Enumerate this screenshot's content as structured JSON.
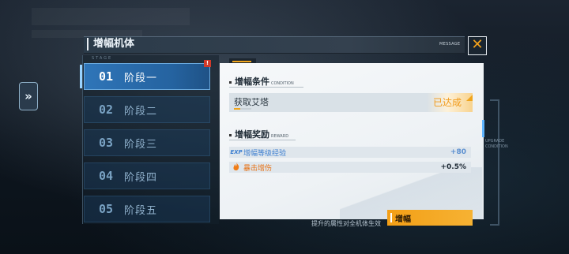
{
  "header": {
    "title": "增幅机体",
    "message_label": "MESSAGE",
    "close_glyph": "✕"
  },
  "nav": {
    "side_arrow": "»"
  },
  "stages": {
    "label": "STAGE",
    "badge": "!",
    "items": [
      {
        "num": "01",
        "name": "阶段一",
        "active": true
      },
      {
        "num": "02",
        "name": "阶段二",
        "active": false
      },
      {
        "num": "03",
        "name": "阶段三",
        "active": false
      },
      {
        "num": "04",
        "name": "阶段四",
        "active": false
      },
      {
        "num": "05",
        "name": "阶段五",
        "active": false
      }
    ]
  },
  "condition": {
    "title": "增幅条件",
    "title_en": "CONDITION",
    "item": "获取艾塔",
    "status": "已达成"
  },
  "reward": {
    "title": "增幅奖励",
    "title_en": "REWARD",
    "items": [
      {
        "icon": "EXP",
        "name": "增幅等级经验",
        "value": "+80"
      },
      {
        "icon": "fire-icon",
        "name": "暴击增伤",
        "value": "+0.5%"
      }
    ]
  },
  "side_scale": "UPGRADE CONDITION",
  "footer": {
    "note": "提升的属性对全机体生效",
    "enhance_button": "增幅"
  },
  "colors": {
    "accent": "#f39f16",
    "active_stage": "#2f75b8",
    "status": "#f19a1a"
  }
}
